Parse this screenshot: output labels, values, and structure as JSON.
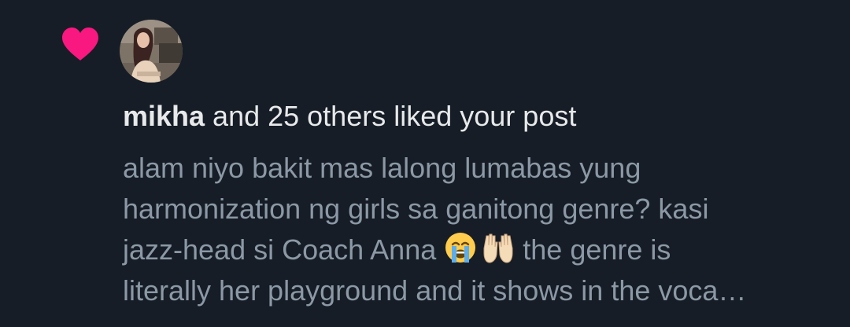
{
  "notification": {
    "icon": "heart-icon",
    "accent_color": "#f91880",
    "username": "mikha",
    "action_text": " and 25 others liked your post",
    "post_lines": [
      "alam niyo bakit mas lalong lumabas yung",
      "harmonization ng girls sa ganitong genre? kasi",
      "jazz-head si Coach Anna ",
      " the genre is",
      "literally her playground and it shows in the voca…"
    ],
    "emojis": [
      "loudly-crying-face-emoji",
      "raising-hands-emoji"
    ]
  }
}
